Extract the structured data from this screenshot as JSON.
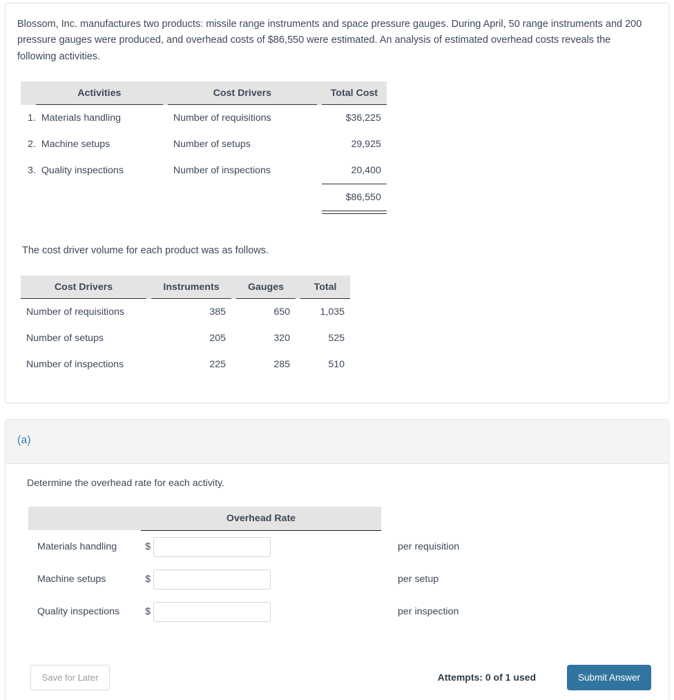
{
  "problem": {
    "intro": "Blossom, Inc. manufactures two products: missile range instruments and space pressure gauges. During April, 50 range instruments and 200 pressure gauges were produced, and overhead costs of $86,550 were estimated. An analysis of estimated overhead costs reveals the following activities.",
    "activities_table": {
      "headers": [
        "Activities",
        "Cost Drivers",
        "Total Cost"
      ],
      "rows": [
        {
          "index": "1.",
          "activity": "Materials handling",
          "driver": "Number of requisitions",
          "cost": "$36,225"
        },
        {
          "index": "2.",
          "activity": "Machine setups",
          "driver": "Number of setups",
          "cost": "29,925"
        },
        {
          "index": "3.",
          "activity": "Quality inspections",
          "driver": "Number of inspections",
          "cost": "20,400"
        }
      ],
      "total": "$86,550"
    },
    "volume_lead_in": "The cost driver volume for each product was as follows.",
    "volume_table": {
      "headers": [
        "Cost Drivers",
        "Instruments",
        "Gauges",
        "Total"
      ],
      "rows": [
        {
          "driver": "Number of requisitions",
          "instruments": "385",
          "gauges": "650",
          "total": "1,035"
        },
        {
          "driver": "Number of setups",
          "instruments": "205",
          "gauges": "320",
          "total": "525"
        },
        {
          "driver": "Number of inspections",
          "instruments": "225",
          "gauges": "285",
          "total": "510"
        }
      ]
    }
  },
  "answer": {
    "part_label": "(a)",
    "question": "Determine the overhead rate for each activity.",
    "rate_table": {
      "blank_header": "",
      "rate_header": "Overhead Rate",
      "rows": [
        {
          "label": "Materials handling",
          "currency": "$",
          "value": "",
          "placeholder": "",
          "unit": "per requisition"
        },
        {
          "label": "Machine setups",
          "currency": "$",
          "value": "",
          "placeholder": "",
          "unit": "per setup"
        },
        {
          "label": "Quality inspections",
          "currency": "$",
          "value": "",
          "placeholder": "",
          "unit": "per inspection"
        }
      ]
    },
    "footer": {
      "save_for_later": "Save for Later",
      "attempts": "Attempts: 0 of 1 used",
      "submit": "Submit Answer"
    }
  },
  "colors": {
    "accent_blue": "#3f7ca8",
    "submit_blue": "#31749f",
    "table_header_gray": "#e4e4e4",
    "panel_header_gray": "#f4f4f4",
    "text": "#3c4858"
  }
}
